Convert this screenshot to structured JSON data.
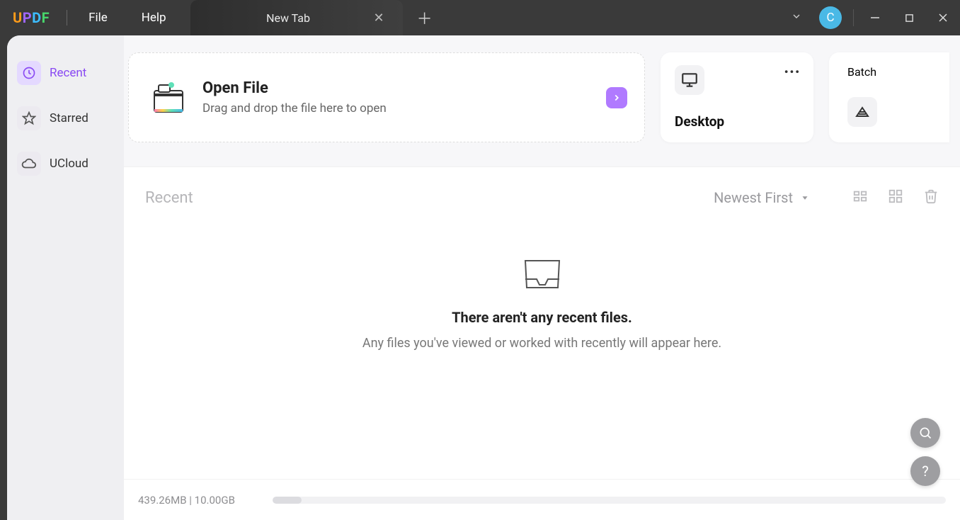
{
  "app": {
    "logo": "UPDF"
  },
  "menu": {
    "file": "File",
    "help": "Help"
  },
  "tab": {
    "label": "New Tab"
  },
  "avatar": {
    "letter": "C"
  },
  "sidebar": {
    "items": [
      {
        "label": "Recent",
        "icon": "clock-icon",
        "active": true
      },
      {
        "label": "Starred",
        "icon": "star-icon",
        "active": false
      },
      {
        "label": "UCloud",
        "icon": "cloud-icon",
        "active": false
      }
    ]
  },
  "open_card": {
    "title": "Open File",
    "subtitle": "Drag and drop the file here to open"
  },
  "tiles": {
    "desktop": "Desktop",
    "batch": "Batch"
  },
  "recent": {
    "heading": "Recent",
    "sort": "Newest First",
    "empty_title": "There aren't any recent files.",
    "empty_subtitle": "Any files you've viewed or worked with recently will appear here."
  },
  "storage": {
    "used": "439.26MB",
    "separator": " | ",
    "total": "10.00GB",
    "percent": 4.3
  }
}
